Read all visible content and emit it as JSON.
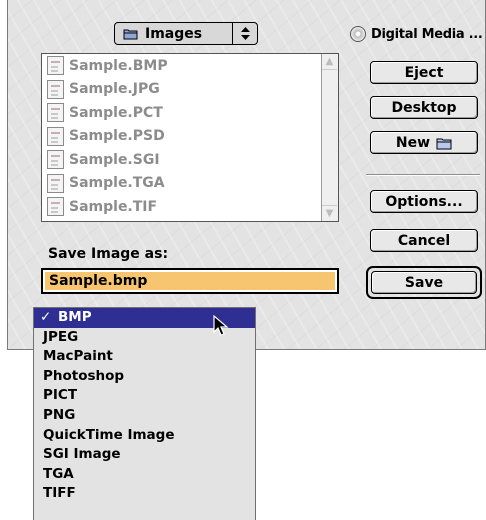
{
  "folder_popup": {
    "label": "Images",
    "icon": "folder-icon"
  },
  "disk": {
    "label": "Digital Media ...",
    "icon": "cd-disk-icon"
  },
  "file_list": {
    "items": [
      {
        "name": "Sample.BMP"
      },
      {
        "name": "Sample.JPG"
      },
      {
        "name": "Sample.PCT"
      },
      {
        "name": "Sample.PSD"
      },
      {
        "name": "Sample.SGI"
      },
      {
        "name": "Sample.TGA"
      },
      {
        "name": "Sample.TIF"
      }
    ]
  },
  "buttons": {
    "eject": "Eject",
    "desktop": "Desktop",
    "new": "New",
    "options": "Options...",
    "cancel": "Cancel",
    "save": "Save"
  },
  "save_as": {
    "label": "Save Image as:",
    "value": "Sample.bmp"
  },
  "format_menu": {
    "selected_check": "✓",
    "items": [
      "BMP",
      "JPEG",
      "MacPaint",
      "Photoshop",
      "PICT",
      "PNG",
      "QuickTime Image",
      "SGI Image",
      "TGA",
      "TIFF"
    ]
  },
  "colors": {
    "dialog_bg": "#e3e3e3",
    "name_field_highlight": "#f7c56f",
    "menu_selection": "#2e2e93"
  }
}
